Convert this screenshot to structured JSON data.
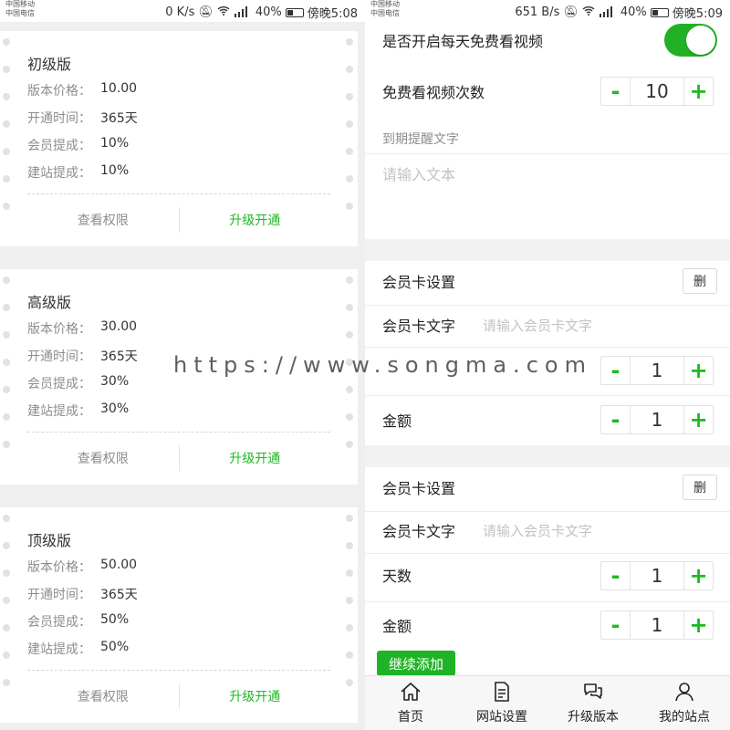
{
  "left": {
    "status": {
      "carrier1": "中国移动",
      "carrier2": "中国电信",
      "speed": "0 K/s",
      "signal_label": "4G",
      "battery": "40%",
      "time": "傍晚5:08"
    },
    "cards": [
      {
        "title": "初级版",
        "rows": [
          {
            "label": "版本价格：",
            "value": "10.00"
          },
          {
            "label": "开通时间：",
            "value": "365天"
          },
          {
            "label": "会员提成：",
            "value": "10%"
          },
          {
            "label": "建站提成：",
            "value": "10%"
          }
        ],
        "view_label": "查看权限",
        "upgrade_label": "升级开通"
      },
      {
        "title": "高级版",
        "rows": [
          {
            "label": "版本价格：",
            "value": "30.00"
          },
          {
            "label": "开通时间：",
            "value": "365天"
          },
          {
            "label": "会员提成：",
            "value": "30%"
          },
          {
            "label": "建站提成：",
            "value": "30%"
          }
        ],
        "view_label": "查看权限",
        "upgrade_label": "升级开通"
      },
      {
        "title": "顶级版",
        "rows": [
          {
            "label": "版本价格：",
            "value": "50.00"
          },
          {
            "label": "开通时间：",
            "value": "365天"
          },
          {
            "label": "会员提成：",
            "value": "50%"
          },
          {
            "label": "建站提成：",
            "value": "50%"
          }
        ],
        "view_label": "查看权限",
        "upgrade_label": "升级开通"
      }
    ]
  },
  "right": {
    "status": {
      "carrier1": "中国移动",
      "carrier2": "中国电信",
      "speed": "651 B/s",
      "signal_label": "4G",
      "battery": "40%",
      "time": "傍晚5:09"
    },
    "free_video_toggle_label": "是否开启每天免费看视频",
    "free_video_toggle_on": true,
    "free_video_count_label": "免费看视频次数",
    "free_video_count": "10",
    "expire_text_label": "到期提醒文字",
    "expire_text_placeholder": "请输入文本",
    "card_settings": [
      {
        "title": "会员卡设置",
        "delete_label": "删",
        "text_label": "会员卡文字",
        "text_placeholder": "请输入会员卡文字",
        "days_label": "",
        "days_value": "1",
        "amount_label": "金额",
        "amount_value": "1"
      },
      {
        "title": "会员卡设置",
        "delete_label": "删",
        "text_label": "会员卡文字",
        "text_placeholder": "请输入会员卡文字",
        "days_label": "天数",
        "days_value": "1",
        "amount_label": "金额",
        "amount_value": "1"
      }
    ],
    "add_more_label": "继续添加",
    "tabs": [
      {
        "label": "首页",
        "icon": "home-icon"
      },
      {
        "label": "网站设置",
        "icon": "document-icon"
      },
      {
        "label": "升级版本",
        "icon": "chat-icon"
      },
      {
        "label": "我的站点",
        "icon": "user-icon"
      }
    ]
  },
  "watermark": "https://www.songma.com",
  "colors": {
    "accent_green": "#1fb922",
    "toggle_green": "#22b024",
    "muted_text": "#8d8d8d",
    "placeholder": "#c3c3c3"
  }
}
